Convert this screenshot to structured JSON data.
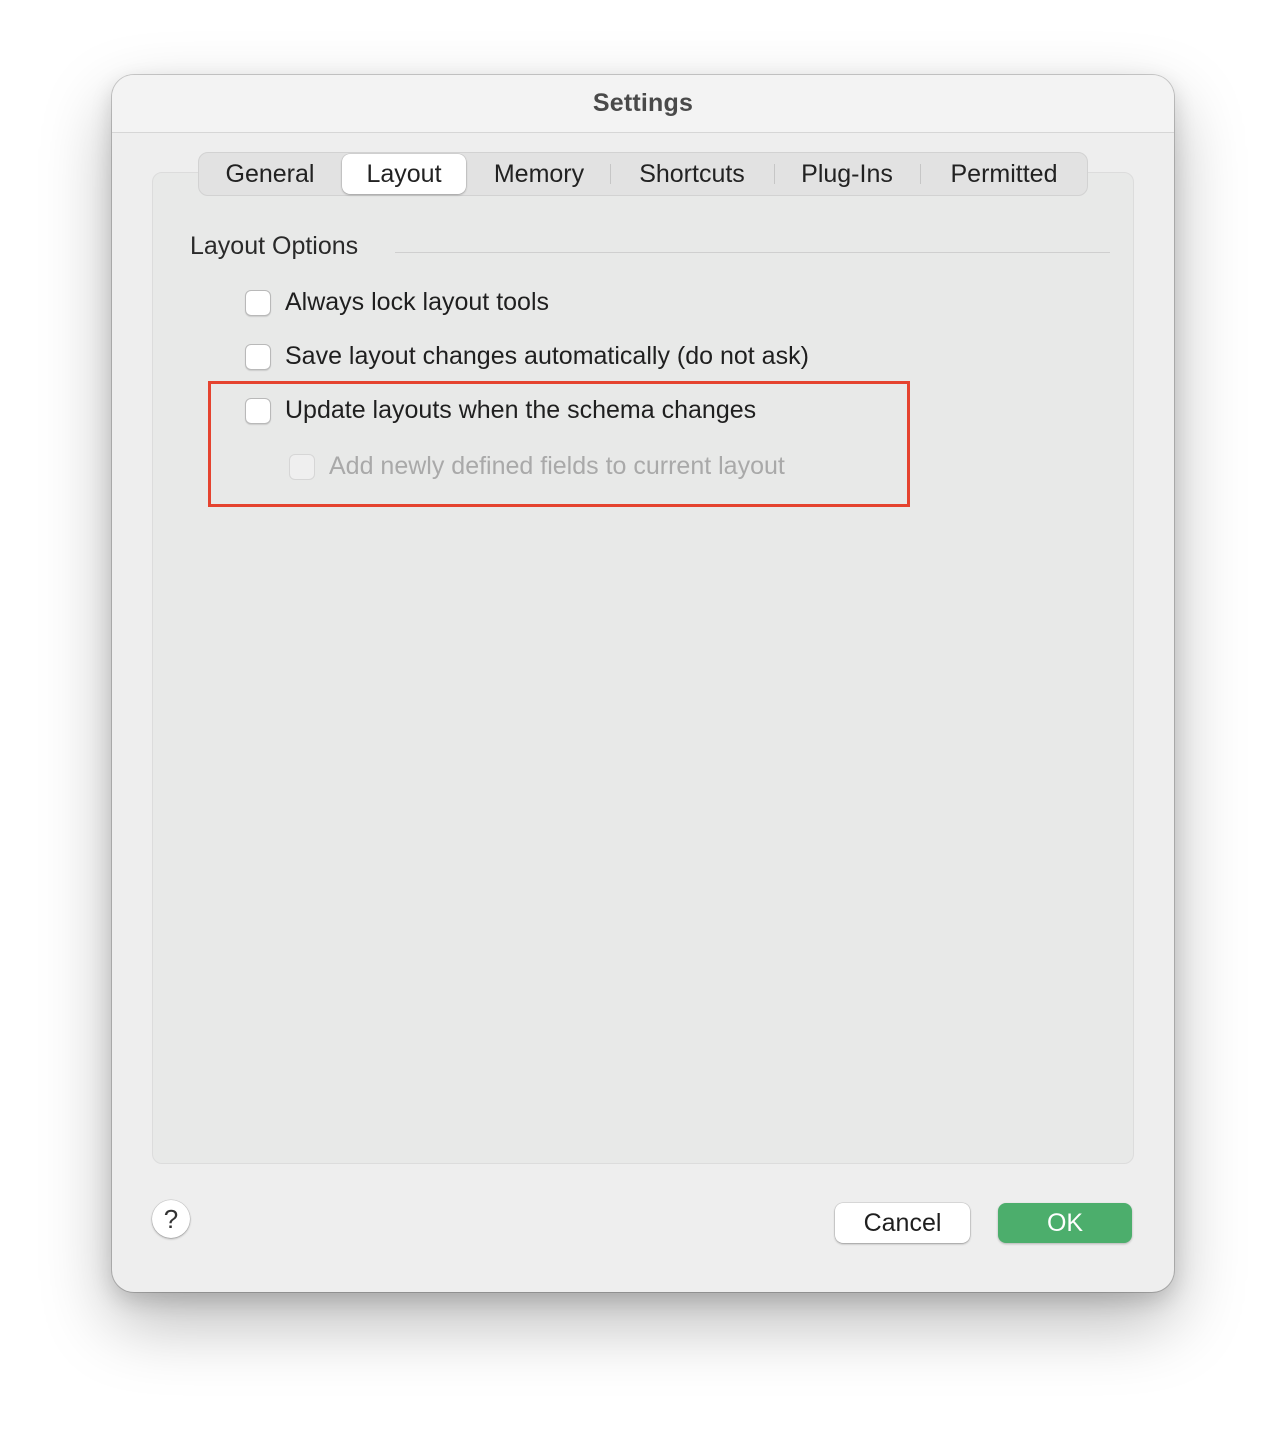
{
  "window": {
    "title": "Settings"
  },
  "tabs": [
    {
      "label": "General",
      "active": false
    },
    {
      "label": "Layout",
      "active": true
    },
    {
      "label": "Memory",
      "active": false
    },
    {
      "label": "Shortcuts",
      "active": false
    },
    {
      "label": "Plug-Ins",
      "active": false
    },
    {
      "label": "Permitted",
      "active": false
    }
  ],
  "layout_options": {
    "section_title": "Layout Options",
    "options": [
      {
        "label": "Always lock layout tools",
        "checked": false,
        "enabled": true
      },
      {
        "label": "Save layout changes automatically (do not ask)",
        "checked": false,
        "enabled": true
      },
      {
        "label": "Update layouts when the schema changes",
        "checked": false,
        "enabled": true
      },
      {
        "label": "Add newly defined fields to current layout",
        "checked": false,
        "enabled": false
      }
    ]
  },
  "footer": {
    "help_label": "?",
    "cancel_label": "Cancel",
    "ok_label": "OK"
  },
  "colors": {
    "ok_button": "#4cae6c",
    "highlight_border": "#e5432f"
  }
}
